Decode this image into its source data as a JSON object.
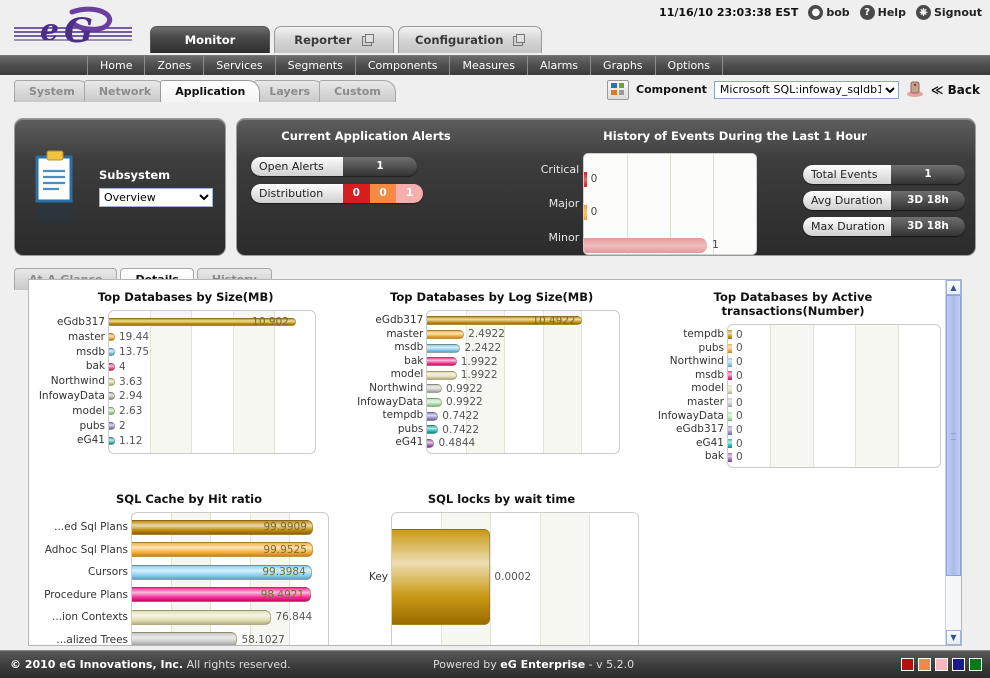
{
  "header": {
    "logo_text": "eG",
    "timestamp": "11/16/10 23:03:38 EST",
    "user": "bob",
    "help": "Help",
    "signout": "Signout",
    "main_tabs": [
      {
        "label": "Monitor",
        "active": true,
        "popout": false
      },
      {
        "label": "Reporter",
        "active": false,
        "popout": true
      },
      {
        "label": "Configuration",
        "active": false,
        "popout": true
      }
    ],
    "sub_nav": [
      "Home",
      "Zones",
      "Services",
      "Segments",
      "Components",
      "Measures",
      "Alarms",
      "Graphs",
      "Options"
    ]
  },
  "layer_tabs": [
    {
      "label": "System",
      "active": false
    },
    {
      "label": "Network",
      "active": false
    },
    {
      "label": "Application",
      "active": true
    },
    {
      "label": "Layers",
      "active": false
    },
    {
      "label": "Custom",
      "active": false
    }
  ],
  "component_bar": {
    "label": "Component",
    "value": "Microsoft SQL:infoway_sqldb1",
    "back": "≪ Back"
  },
  "subsystem_panel": {
    "label": "Subsystem",
    "value": "Overview"
  },
  "alerts_panel": {
    "title": "Current Application Alerts",
    "open_alerts_label": "Open Alerts",
    "open_alerts_value": "1",
    "distribution_label": "Distribution",
    "distribution": [
      {
        "value": "0",
        "color": "#d81e1e"
      },
      {
        "value": "0",
        "color": "#f58b43"
      },
      {
        "value": "1",
        "color": "#f6afaf"
      }
    ]
  },
  "events_panel": {
    "title": "History of Events During the Last 1 Hour",
    "stats": [
      {
        "label": "Total Events",
        "value": "1"
      },
      {
        "label": "Avg Duration",
        "value": "3D 18h"
      },
      {
        "label": "Max Duration",
        "value": "3D 18h"
      }
    ]
  },
  "inner_tabs": [
    {
      "label": "At-A-Glance",
      "active": false
    },
    {
      "label": "Details",
      "active": true
    },
    {
      "label": "History",
      "active": false
    }
  ],
  "footer": {
    "copyright_strong": "© 2010 eG Innovations, Inc.",
    "copyright_rest": " All rights reserved.",
    "powered_prefix": "Powered by ",
    "powered_strong": "eG Enterprise",
    "version": " - v 5.2.0",
    "swatches": [
      "#b50f0f",
      "#f08a4b",
      "#f8b6bd",
      "#1a1a8c",
      "#0b7a16"
    ]
  },
  "chart_data": [
    {
      "id": "events",
      "type": "bar",
      "title": "History of Events During the Last 1 Hour",
      "orientation": "horizontal",
      "categories": [
        "Critical",
        "Major",
        "Minor"
      ],
      "values": [
        0,
        0,
        1
      ],
      "labels": [
        "0",
        "0",
        "1"
      ],
      "colors": [
        "#cc2222",
        "#f2a33c",
        "#e59a9a"
      ],
      "xlim": [
        0,
        1.4
      ],
      "grid": true,
      "xlabel": "",
      "ylabel": ""
    },
    {
      "id": "db-size",
      "type": "bar",
      "title": "Top Databases by Size(MB)",
      "orientation": "horizontal",
      "categories": [
        "eGdb317",
        "master",
        "msdb",
        "bak",
        "Northwind",
        "InfowayData",
        "model",
        "pubs",
        "eG41"
      ],
      "values": [
        10902,
        19.44,
        13.75,
        4,
        3.63,
        2.94,
        2.63,
        2,
        1.12
      ],
      "labels": [
        "10.902",
        "19.44",
        "13.75",
        "4",
        "3.63",
        "2.94",
        "2.63",
        "2",
        "1.12"
      ],
      "colors": [
        "#c99a16",
        "#f6a93b",
        "#7fc5ea",
        "#ef4fa0",
        "#d8d6ab",
        "#b8b8b8",
        "#a9dca9",
        "#9b93cf",
        "#3fbfbf"
      ],
      "xlim": [
        0,
        12000
      ],
      "grid": true
    },
    {
      "id": "db-logsize",
      "type": "bar",
      "title": "Top Databases by Log Size(MB)",
      "orientation": "horizontal",
      "categories": [
        "eGdb317",
        "master",
        "msdb",
        "bak",
        "model",
        "Northwind",
        "InfowayData",
        "tempdb",
        "pubs",
        "eG41"
      ],
      "values": [
        10.4922,
        2.4922,
        2.2422,
        1.9922,
        1.9922,
        0.9922,
        0.9922,
        0.7422,
        0.7422,
        0.4844
      ],
      "labels": [
        "10.4922",
        "2.4922",
        "2.2422",
        "1.9922",
        "1.9922",
        "0.9922",
        "0.9922",
        "0.7422",
        "0.7422",
        "0.4844"
      ],
      "colors": [
        "#c99a16",
        "#f6b23e",
        "#8dcdef",
        "#f5439a",
        "#dedbb2",
        "#c9c9c9",
        "#b1e2b1",
        "#9b93cf",
        "#2fbcbc",
        "#a96fbf"
      ],
      "xlim": [
        0,
        13
      ],
      "grid": true
    },
    {
      "id": "db-activetx",
      "type": "bar",
      "title": "Top Databases by Active transactions(Number)",
      "orientation": "horizontal",
      "categories": [
        "tempdb",
        "pubs",
        "Northwind",
        "msdb",
        "model",
        "master",
        "InfowayData",
        "eGdb317",
        "eG41",
        "bak"
      ],
      "values": [
        0,
        0,
        0,
        0,
        0,
        0,
        0,
        0,
        0,
        0
      ],
      "labels": [
        "0",
        "0",
        "0",
        "0",
        "0",
        "0",
        "0",
        "0",
        "0",
        "0"
      ],
      "colors": [
        "#c99a16",
        "#f6b23e",
        "#8dcdef",
        "#f5439a",
        "#dedbb2",
        "#c9c9c9",
        "#b1e2b1",
        "#9b93cf",
        "#2fbcbc",
        "#a96fbf"
      ],
      "xlim": [
        0,
        1
      ],
      "grid": true
    },
    {
      "id": "sql-cache",
      "type": "bar",
      "title": "SQL Cache by Hit ratio",
      "orientation": "horizontal",
      "categories": [
        "...ed Sql Plans",
        "Adhoc Sql Plans",
        "Cursors",
        "Procedure Plans",
        "...ion Contexts",
        "...alized Trees"
      ],
      "values": [
        99.9909,
        99.9525,
        99.3984,
        98.4921,
        76.844,
        58.1027
      ],
      "labels": [
        "99.9909",
        "99.9525",
        "99.3984",
        "98.4921",
        "76.844",
        "58.1027"
      ],
      "colors": [
        "#c08d10",
        "#f6b23e",
        "#8dd2f4",
        "#f5349a",
        "#e2e0b4",
        "#c6c6c6"
      ],
      "xlim": [
        0,
        108
      ],
      "grid": true
    },
    {
      "id": "sql-locks",
      "type": "bar",
      "title": "SQL locks by wait time",
      "orientation": "horizontal",
      "categories": [
        "Key"
      ],
      "values": [
        0.0002
      ],
      "labels": [
        "0.0002"
      ],
      "colors": [
        "#c99a16"
      ],
      "xlim": [
        0,
        0.0005
      ],
      "grid": true
    }
  ]
}
